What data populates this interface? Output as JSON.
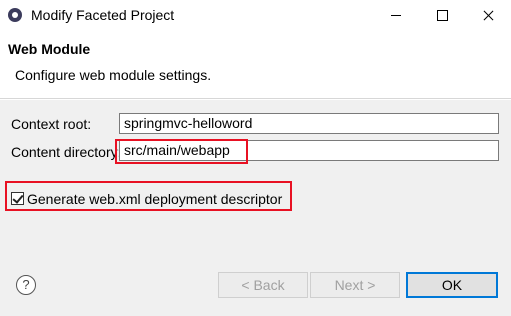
{
  "window": {
    "title": "Modify Faceted Project"
  },
  "header": {
    "title": "Web Module",
    "description": "Configure web module settings."
  },
  "form": {
    "context_root": {
      "label": "Context root:",
      "value": "springmvc-helloword"
    },
    "content_directory": {
      "label": "Content directory:",
      "value": "src/main/webapp"
    },
    "generate_descriptor": {
      "label": "Generate web.xml deployment descriptor",
      "checked": true
    }
  },
  "buttons": {
    "back": "< Back",
    "next": "Next >",
    "ok": "OK",
    "help": "?"
  },
  "colors": {
    "highlight": "#e81123",
    "focus": "#0078d7"
  }
}
